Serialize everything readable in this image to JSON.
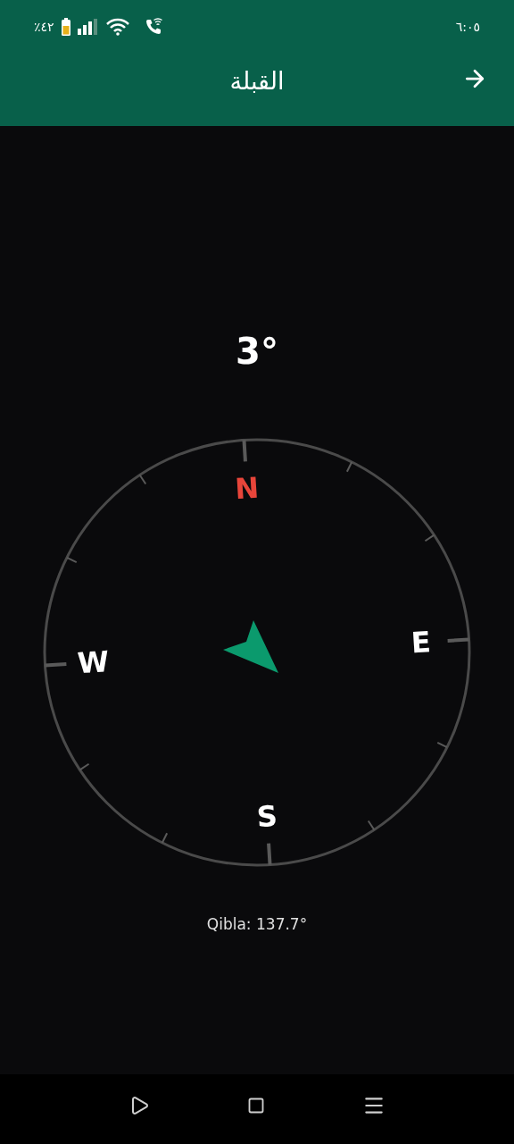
{
  "status_bar": {
    "time": "٦:٠٥",
    "battery": "٪٤٢"
  },
  "header": {
    "title": "القبلة"
  },
  "compass": {
    "heading": "3°",
    "directions": [
      {
        "label": "N",
        "kind": "north"
      },
      {
        "label": "E",
        "kind": "east"
      },
      {
        "label": "S",
        "kind": "south"
      },
      {
        "label": "W",
        "kind": "west"
      }
    ],
    "qibla": "Qibla: 137.7°"
  }
}
